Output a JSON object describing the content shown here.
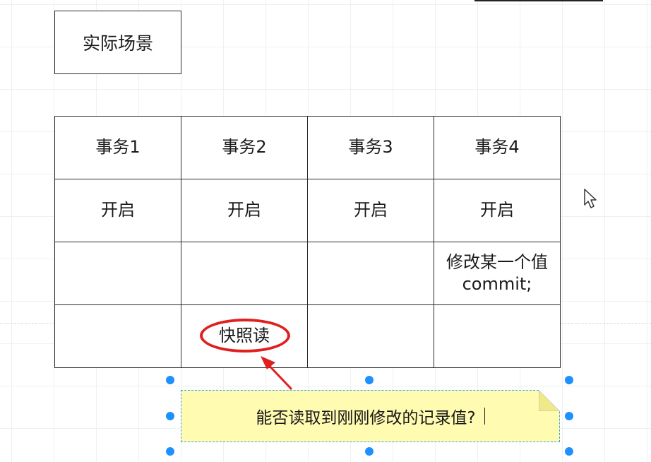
{
  "scene_label": "实际场景",
  "table": {
    "headers": [
      "事务1",
      "事务2",
      "事务3",
      "事务4"
    ],
    "rows": [
      [
        "开启",
        "开启",
        "开启",
        "开启"
      ],
      [
        "",
        "",
        "",
        ""
      ],
      [
        "",
        "快照读",
        "",
        ""
      ]
    ],
    "modify_line1": "修改某一个值",
    "modify_line2": "commit;"
  },
  "note": {
    "text": "能否读取到刚刚修改的记录值?"
  },
  "colors": {
    "highlight": "#e01f1f",
    "note_bg": "#fffbb0",
    "selection": "#1e90ff"
  },
  "icons": [
    "mouse-pointer-icon"
  ]
}
